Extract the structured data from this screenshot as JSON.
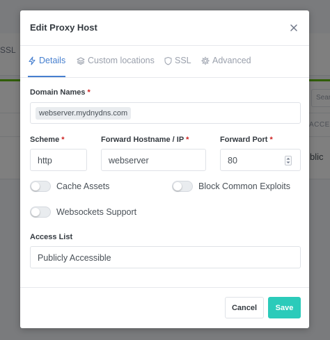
{
  "background": {
    "ssl_text": "SSL",
    "search_text": "Sear",
    "access_col": "ACCESS",
    "public_text": "blic"
  },
  "modal": {
    "title": "Edit Proxy Host",
    "close_icon": "close-icon"
  },
  "tabs": [
    {
      "label": "Details",
      "icon": "bolt-icon",
      "active": true
    },
    {
      "label": "Custom locations",
      "icon": "layers-icon",
      "active": false
    },
    {
      "label": "SSL",
      "icon": "shield-icon",
      "active": false
    },
    {
      "label": "Advanced",
      "icon": "gear-icon",
      "active": false
    }
  ],
  "form": {
    "domain_names": {
      "label": "Domain Names",
      "required_mark": "*",
      "tags": [
        "webserver.mydnydns.com"
      ]
    },
    "scheme": {
      "label": "Scheme",
      "required_mark": "*",
      "value": "http"
    },
    "forward_host": {
      "label": "Forward Hostname / IP",
      "required_mark": "*",
      "value": "webserver"
    },
    "forward_port": {
      "label": "Forward Port",
      "required_mark": "*",
      "value": "80"
    },
    "toggles": {
      "cache_assets": {
        "label": "Cache Assets",
        "on": false
      },
      "block_exploits": {
        "label": "Block Common Exploits",
        "on": false
      },
      "websockets": {
        "label": "Websockets Support",
        "on": false
      }
    },
    "access_list": {
      "label": "Access List",
      "value": "Publicly Accessible"
    }
  },
  "footer": {
    "cancel_label": "Cancel",
    "save_label": "Save"
  },
  "colors": {
    "accent": "#467fcf",
    "save": "#2bcbba",
    "required": "#cd201f",
    "status_green": "#5eba00"
  }
}
